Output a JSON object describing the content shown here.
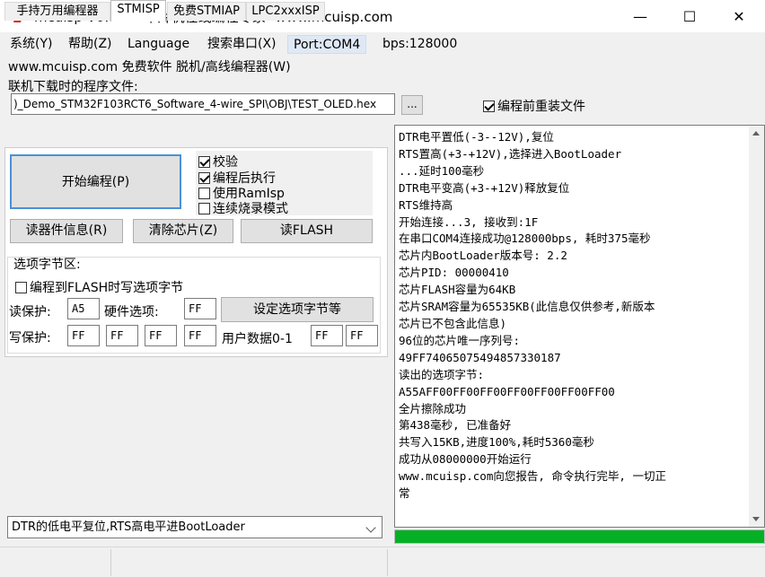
{
  "window": {
    "title": "mcuisp V0.993--单片机在线编程专家--www.mcuisp.com",
    "minimize": "—",
    "maximize": "☐",
    "close": "✕"
  },
  "menu": {
    "items": [
      "系统(Y)",
      "帮助(Z)",
      "Language",
      "搜索串口(X)",
      "Port:COM4",
      "bps:128000"
    ],
    "row2": "www.mcuisp.com 免费软件 脱机/高线编程器(W)"
  },
  "file": {
    "label": "联机下载时的程序文件:",
    "path": ")_Demo_STM32F103RCT6_Software_4-wire_SPI\\OBJ\\TEST_OLED.hex",
    "browse": "...",
    "reload_label": "编程前重装文件",
    "reload_checked": true
  },
  "tabs": [
    "手持万用编程器",
    "STMISP",
    "免费STMIAP",
    "LPC2xxxISP"
  ],
  "buttons": {
    "program": "开始编程(P)",
    "read_info": "读器件信息(R)",
    "erase": "清除芯片(Z)",
    "read_flash": "读FLASH",
    "set_option": "设定选项字节等"
  },
  "options": [
    {
      "label": "校验",
      "checked": true
    },
    {
      "label": "编程后执行",
      "checked": true
    },
    {
      "label": "使用RamIsp",
      "checked": false
    },
    {
      "label": "连续烧录模式",
      "checked": false
    }
  ],
  "option_bytes": {
    "group_title": "选项字节区:",
    "write_on_flash": "编程到FLASH时写选项字节",
    "read_protect_label": "读保护:",
    "read_protect": "A5",
    "hw_option_label": "硬件选项:",
    "hw_option": "FF",
    "write_protect_label": "写保护:",
    "write_protect": [
      "FF",
      "FF",
      "FF",
      "FF"
    ],
    "user_data_label": "用户数据0-1",
    "user_data": [
      "FF",
      "FF"
    ]
  },
  "reset_mode": "DTR的低电平复位,RTS高电平进BootLoader",
  "log": [
    "DTR电平置低(-3--12V),复位",
    "RTS置高(+3-+12V),选择进入BootLoader",
    "...延时100毫秒",
    "DTR电平变高(+3-+12V)释放复位",
    "RTS维持高",
    "开始连接...3, 接收到:1F",
    "在串口COM4连接成功@128000bps, 耗时375毫秒",
    "芯片内BootLoader版本号: 2.2",
    "芯片PID: 00000410",
    "芯片FLASH容量为64KB",
    "芯片SRAM容量为65535KB(此信息仅供参考,新版本",
    "芯片已不包含此信息)",
    "96位的芯片唯一序列号:",
    "49FF74065075494857330187",
    "读出的选项字节:",
    "A55AFF00FF00FF00FF00FF00FF00FF00",
    "全片擦除成功",
    "第438毫秒, 已准备好",
    "共写入15KB,进度100%,耗时5360毫秒",
    "成功从08000000开始运行",
    "www.mcuisp.com向您报告, 命令执行完毕, 一切正",
    "常"
  ],
  "progress": 1.0,
  "colors": {
    "progress": "#06b025",
    "accent": "#4a90d9",
    "icon_red": "#d9261c"
  }
}
